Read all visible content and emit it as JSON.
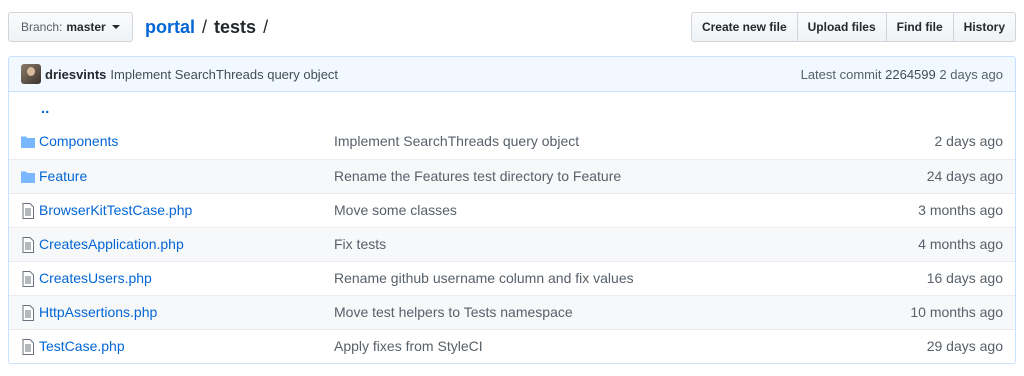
{
  "branch": {
    "label": "Branch:",
    "name": "master"
  },
  "breadcrumb": {
    "root": "portal",
    "separator": "/",
    "current": "tests",
    "trailing": "/"
  },
  "actions": {
    "create_new_file": "Create new file",
    "upload_files": "Upload files",
    "find_file": "Find file",
    "history": "History"
  },
  "commit": {
    "author": "driesvints",
    "message": "Implement SearchThreads query object",
    "latest_label": "Latest commit",
    "sha": "2264599",
    "age": "2 days ago"
  },
  "parent_link": "..",
  "files": [
    {
      "type": "folder",
      "name": "Components",
      "message": "Implement SearchThreads query object",
      "age": "2 days ago"
    },
    {
      "type": "folder",
      "name": "Feature",
      "message": "Rename the Features test directory to Feature",
      "age": "24 days ago"
    },
    {
      "type": "file",
      "name": "BrowserKitTestCase.php",
      "message": "Move some classes",
      "age": "3 months ago"
    },
    {
      "type": "file",
      "name": "CreatesApplication.php",
      "message": "Fix tests",
      "age": "4 months ago"
    },
    {
      "type": "file",
      "name": "CreatesUsers.php",
      "message": "Rename github username column and fix values",
      "age": "16 days ago"
    },
    {
      "type": "file",
      "name": "HttpAssertions.php",
      "message": "Move test helpers to Tests namespace",
      "age": "10 months ago"
    },
    {
      "type": "file",
      "name": "TestCase.php",
      "message": "Apply fixes from StyleCI",
      "age": "29 days ago"
    }
  ],
  "colors": {
    "link": "#0366d6",
    "folder_icon": "#79b8ff",
    "file_icon": "#6a737d",
    "commit_bg": "#f1f8ff"
  }
}
